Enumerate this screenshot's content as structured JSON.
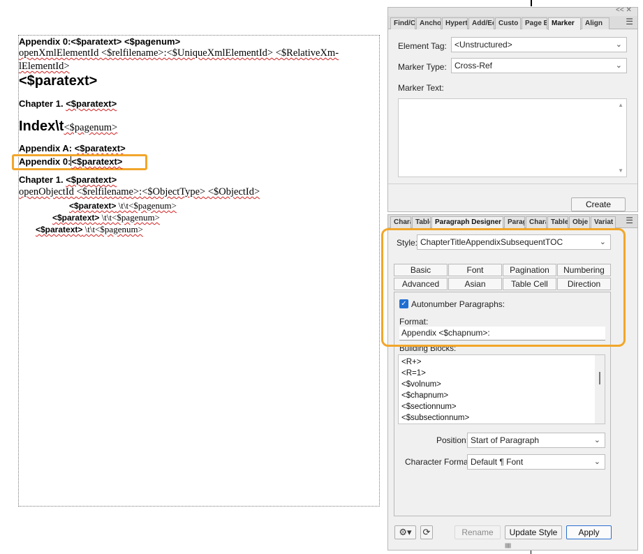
{
  "document": {
    "line1_a": "Appendix 0:<$paratext> <$pagenum>",
    "line2": "openXmlElementId  <$relfilename>:<$UniqueXmlElementId>  <$RelativeXm-",
    "line3": "lElementId>",
    "line4": "<$paratext>",
    "line5_a": "Chapter 1.  ",
    "line5_b": "<$paratext>",
    "line6_a": "Index\\t",
    "line6_b": "<$pagenum>",
    "line7_a": "Appendix A:  ",
    "line7_b": "<$paratext>",
    "line8_a": "Appendix 0:",
    "line8_b": "<$paratext>",
    "line9_a": "Chapter 1.  ",
    "line9_b": "<$paratext>",
    "line10": "openObjectId <$relfilename>:<$ObjectType> <$ObjectId>",
    "line11_a": "<$paratext>",
    "line11_b": " \\t\\t<$pagenum>",
    "line12_a": "<$paratext>",
    "line12_b": " \\t\\t<$pagenum>",
    "line13_a": "<$paratext>",
    "line13_b": " \\t\\t<$pagenum>"
  },
  "marker_panel": {
    "caption_controls": "<<  ✕",
    "tabs": [
      "Find/C",
      "Ancho",
      "Hypert",
      "Add/Ec",
      "Custo",
      "Page B",
      "Marker",
      "Align"
    ],
    "active_tab": "Marker",
    "element_tag_label": "Element Tag:",
    "element_tag_value": "<Unstructured>",
    "marker_type_label": "Marker Type:",
    "marker_type_value": "Cross-Ref",
    "marker_text_label": "Marker Text:",
    "create_button": "Create"
  },
  "para_panel": {
    "tabs": [
      "Chara",
      "Table",
      "Paragraph Designer",
      "Parag",
      "Chara",
      "Table",
      "Obje",
      "Variat"
    ],
    "active_tab": "Paragraph Designer",
    "style_label": "Style:",
    "style_value": "ChapterTitleAppendixSubsequentTOC",
    "subtabs_row1": [
      "Basic",
      "Font",
      "Pagination",
      "Numbering"
    ],
    "subtabs_row2": [
      "Advanced",
      "Asian",
      "Table Cell",
      "Direction"
    ],
    "autonumber_label": "Autonumber Paragraphs:",
    "autonumber_checked": true,
    "format_label": "Format:",
    "format_value": "Appendix <$chapnum>:",
    "building_blocks_label": "Building Blocks:",
    "building_blocks": [
      "<R+>",
      "<R=1>",
      "<$volnum>",
      "<$chapnum>",
      "<$sectionnum>",
      "<$subsectionnum>"
    ],
    "position_label": "Position:",
    "position_value": "Start of Paragraph",
    "char_format_label": "Character Format:",
    "char_format_value": "Default ¶ Font",
    "rename_button": "Rename",
    "update_style_button": "Update Style",
    "apply_button": "Apply"
  },
  "colors": {
    "highlight": "#f2a62a",
    "accent": "#1f6fd1"
  }
}
